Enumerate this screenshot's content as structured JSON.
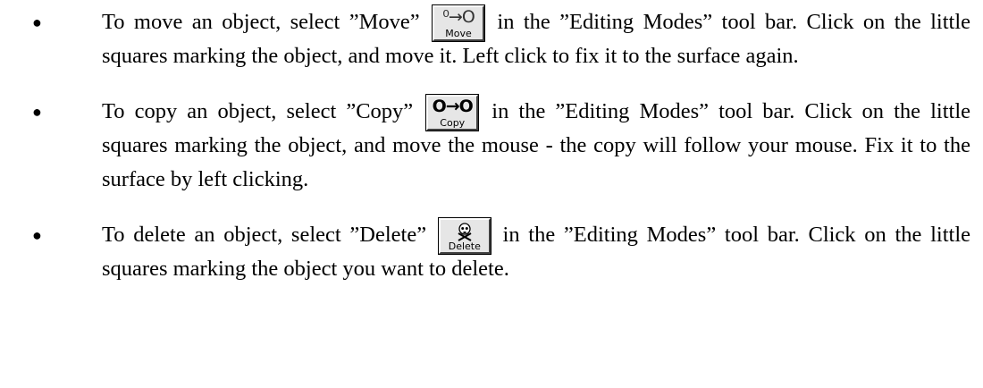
{
  "items": [
    {
      "before": "To move an object, select ”Move”",
      "after": " in the ”Editing Modes” tool bar. Click on the little squares marking the object, and move it. Left click to fix it to the surface again.",
      "button": {
        "glyph": "⁰→O",
        "caption": "Move",
        "icon": "move-icon"
      }
    },
    {
      "before": "To copy an object, select ”Copy”",
      "after": " in the ”Editing Modes” tool bar. Click on the little squares marking the object, and move the mouse - the copy will follow your mouse. Fix it to the surface by left clicking.",
      "button": {
        "glyph": "O→O",
        "caption": "Copy",
        "icon": "copy-icon"
      }
    },
    {
      "before": "To delete an object, select ”Delete”",
      "after": " in the ”Editing Modes” tool bar. Click on the little squares marking the object you want to delete.",
      "button": {
        "caption": "Delete",
        "icon": "skull-crossbones-icon"
      }
    }
  ]
}
